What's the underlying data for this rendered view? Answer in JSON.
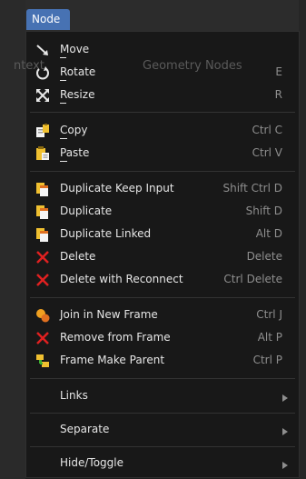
{
  "menu_tab": {
    "label": "Node"
  },
  "background": {
    "breadcrumb_left": "ntext",
    "breadcrumb": "Geometry Nodes",
    "hint_e": "E",
    "hint_r": "R"
  },
  "items": [
    {
      "label": "Move",
      "shortcut": "",
      "icon": "move-icon"
    },
    {
      "label": "Rotate",
      "shortcut": "E",
      "icon": "rotate-icon"
    },
    {
      "label": "Resize",
      "shortcut": "R",
      "icon": "resize-icon"
    },
    {
      "label": "Copy",
      "shortcut": "Ctrl C",
      "icon": "copy-icon"
    },
    {
      "label": "Paste",
      "shortcut": "Ctrl V",
      "icon": "paste-icon"
    },
    {
      "label": "Duplicate Keep Input",
      "shortcut": "Shift Ctrl D",
      "icon": "duplicate-icon"
    },
    {
      "label": "Duplicate",
      "shortcut": "Shift D",
      "icon": "duplicate-icon"
    },
    {
      "label": "Duplicate Linked",
      "shortcut": "Alt D",
      "icon": "duplicate-icon"
    },
    {
      "label": "Delete",
      "shortcut": "Delete",
      "icon": "delete-x-icon"
    },
    {
      "label": "Delete with Reconnect",
      "shortcut": "Ctrl Delete",
      "icon": "delete-x-icon"
    },
    {
      "label": "Join in New Frame",
      "shortcut": "Ctrl J",
      "icon": "join-frame-icon"
    },
    {
      "label": "Remove from Frame",
      "shortcut": "Alt P",
      "icon": "delete-x-icon"
    },
    {
      "label": "Frame Make Parent",
      "shortcut": "Ctrl P",
      "icon": "frame-parent-icon"
    },
    {
      "label": "Links",
      "shortcut": "",
      "icon": ""
    },
    {
      "label": "Separate",
      "shortcut": "",
      "icon": ""
    },
    {
      "label": "Hide/Toggle",
      "shortcut": "",
      "icon": ""
    }
  ],
  "colors": {
    "accent": "#4772b3",
    "menu_bg": "#181818",
    "text": "#e6e6e6",
    "shortcut": "#8e8e8e",
    "delete_red": "#e02020",
    "clipboard_yellow": "#f0c030"
  }
}
